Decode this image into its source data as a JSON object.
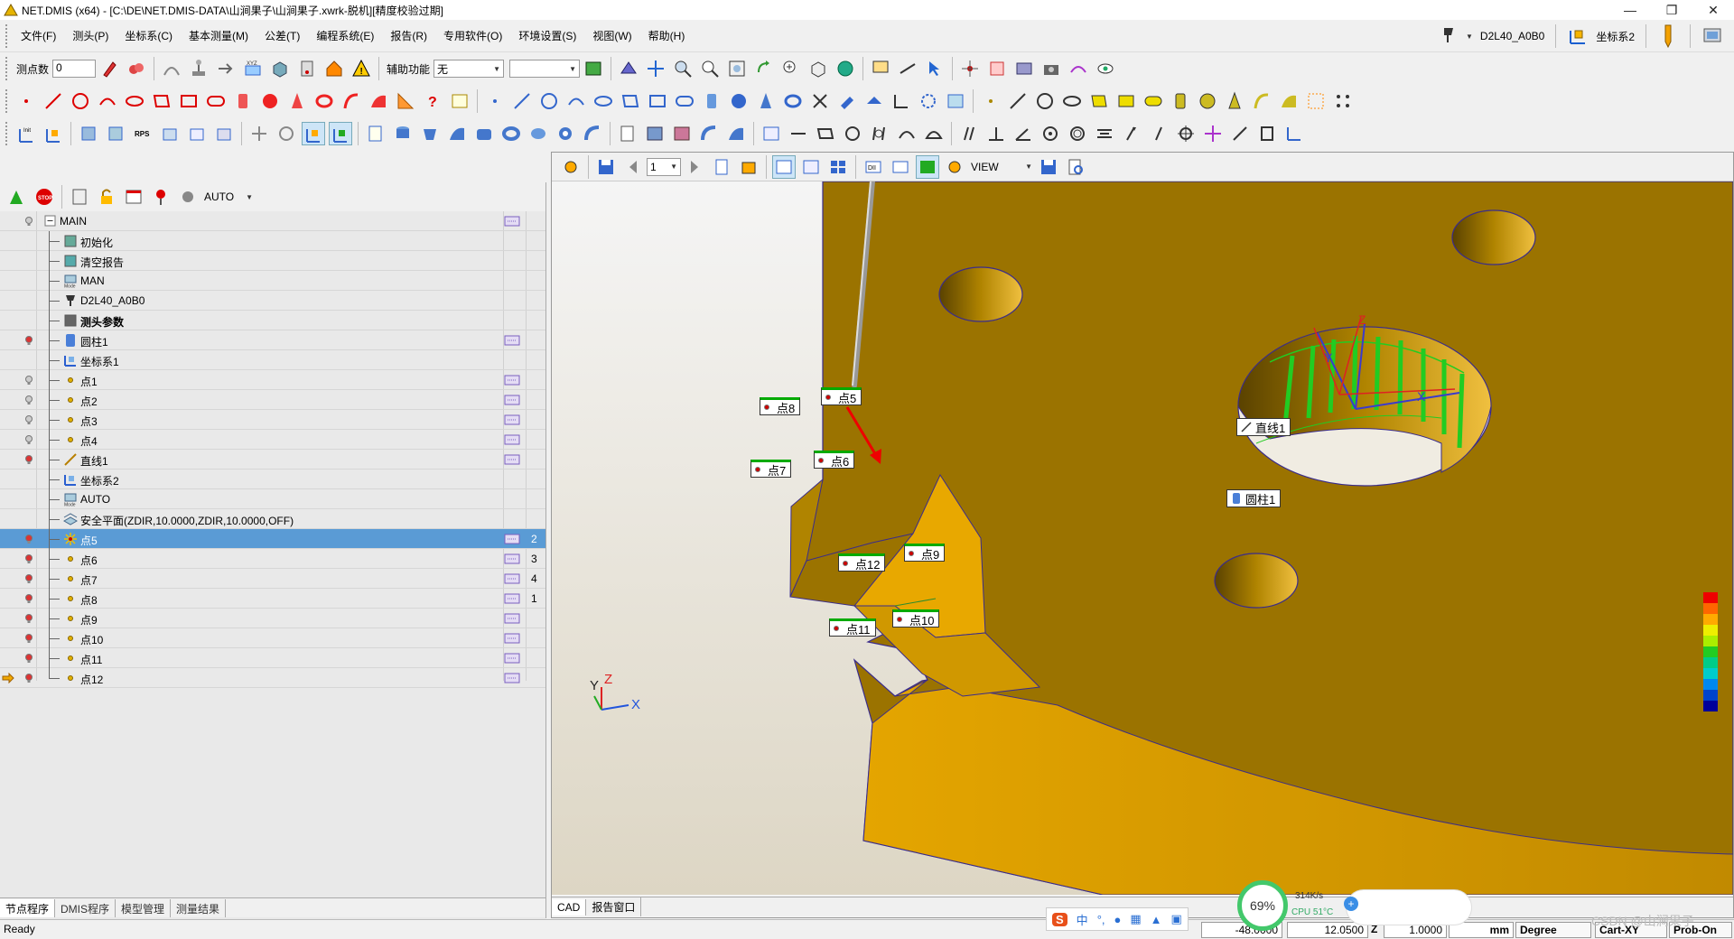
{
  "window": {
    "title": "NET.DMIS (x64) - [C:\\DE\\NET.DMIS-DATA\\山涧果子\\山涧果子.xwrk-脱机][精度校验过期]",
    "controls": [
      "—",
      "❐",
      "✕"
    ]
  },
  "menu": {
    "items": [
      "文件(F)",
      "测头(P)",
      "坐标系(C)",
      "基本测量(M)",
      "公差(T)",
      "编程系统(E)",
      "报告(R)",
      "专用软件(O)",
      "环境设置(S)",
      "视图(W)",
      "帮助(H)"
    ],
    "probe_name": "D2L40_A0B0",
    "coord_system": "坐标系2"
  },
  "toolbar1": {
    "point_count_label": "测点数",
    "point_count_value": "0",
    "aux_label": "辅助功能",
    "aux_value": "无",
    "second_select_value": ""
  },
  "left_toolbar": {
    "mode_value": "AUTO"
  },
  "tree": {
    "rows": [
      {
        "label": "MAIN",
        "bold": false,
        "icon": "minus-box-icon",
        "selected": false,
        "num": ""
      },
      {
        "label": "初始化",
        "icon": "init-icon",
        "num": ""
      },
      {
        "label": "清空报告",
        "icon": "clear-report-icon",
        "num": ""
      },
      {
        "label": "MAN",
        "icon": "mode-icon",
        "num": ""
      },
      {
        "label": "D2L40_A0B0",
        "icon": "probe-icon",
        "num": ""
      },
      {
        "label": "测头参数",
        "icon": "probe-params-icon",
        "num": ""
      },
      {
        "label": "圆柱1",
        "icon": "cylinder-icon",
        "num": ""
      },
      {
        "label": "坐标系1",
        "icon": "coord-system-icon",
        "num": ""
      },
      {
        "label": "点1",
        "icon": "point-icon",
        "num": ""
      },
      {
        "label": "点2",
        "icon": "point-icon",
        "num": ""
      },
      {
        "label": "点3",
        "icon": "point-icon",
        "num": ""
      },
      {
        "label": "点4",
        "icon": "point-icon",
        "num": ""
      },
      {
        "label": "直线1",
        "icon": "line-icon",
        "num": ""
      },
      {
        "label": "坐标系2",
        "icon": "coord-system-icon",
        "num": ""
      },
      {
        "label": "AUTO",
        "icon": "mode-icon",
        "num": ""
      },
      {
        "label": "安全平面(ZDIR,10.0000,ZDIR,10.0000,OFF)",
        "icon": "clearance-plane-icon",
        "num": ""
      },
      {
        "label": "点5",
        "icon": "point-active-icon",
        "num": "2"
      },
      {
        "label": "点6",
        "icon": "point-icon",
        "num": "3"
      },
      {
        "label": "点7",
        "icon": "point-icon",
        "num": "4"
      },
      {
        "label": "点8",
        "icon": "point-icon",
        "num": "1"
      },
      {
        "label": "点9",
        "icon": "point-icon",
        "num": ""
      },
      {
        "label": "点10",
        "icon": "point-icon",
        "num": ""
      },
      {
        "label": "点11",
        "icon": "point-icon",
        "num": ""
      },
      {
        "label": "点12",
        "icon": "point-icon",
        "num": ""
      }
    ]
  },
  "left_tabs": [
    "节点程序",
    "DMIS程序",
    "模型管理",
    "测量结果"
  ],
  "viewport": {
    "page_value": "1",
    "view_value": "VIEW",
    "tabs": [
      "CAD",
      "报告窗口"
    ],
    "labels": {
      "p5": "点5",
      "p6": "点6",
      "p7": "点7",
      "p8": "点8",
      "p9": "点9",
      "p10": "点10",
      "p11": "点11",
      "p12": "点12",
      "line1": "直线1",
      "cyl1": "圆柱1"
    },
    "triad": {
      "x": "X",
      "y": "Y",
      "z": "Z"
    },
    "feature_axes": {
      "x": "X",
      "y": "Y",
      "z": "Z"
    }
  },
  "status": {
    "ready": "Ready",
    "x_value": "-48.0000",
    "y_value": "12.0500",
    "z_label": "Z",
    "z_value": "1.0000",
    "unit": "mm",
    "angle": "Degree",
    "cart": "Cart-XY",
    "probe_on": "Prob-On"
  },
  "overlay": {
    "cpu_percent": "69%",
    "net_speed": "314K/s",
    "cpu_temp": "CPU 51°C",
    "ime_lang": "中",
    "watermark": "CSDN @山涧果子"
  },
  "colors": {
    "part_gold": "#9b7300",
    "part_light": "#e8a800",
    "selected_row": "#5a9bd5",
    "label_green": "#00aa00"
  }
}
